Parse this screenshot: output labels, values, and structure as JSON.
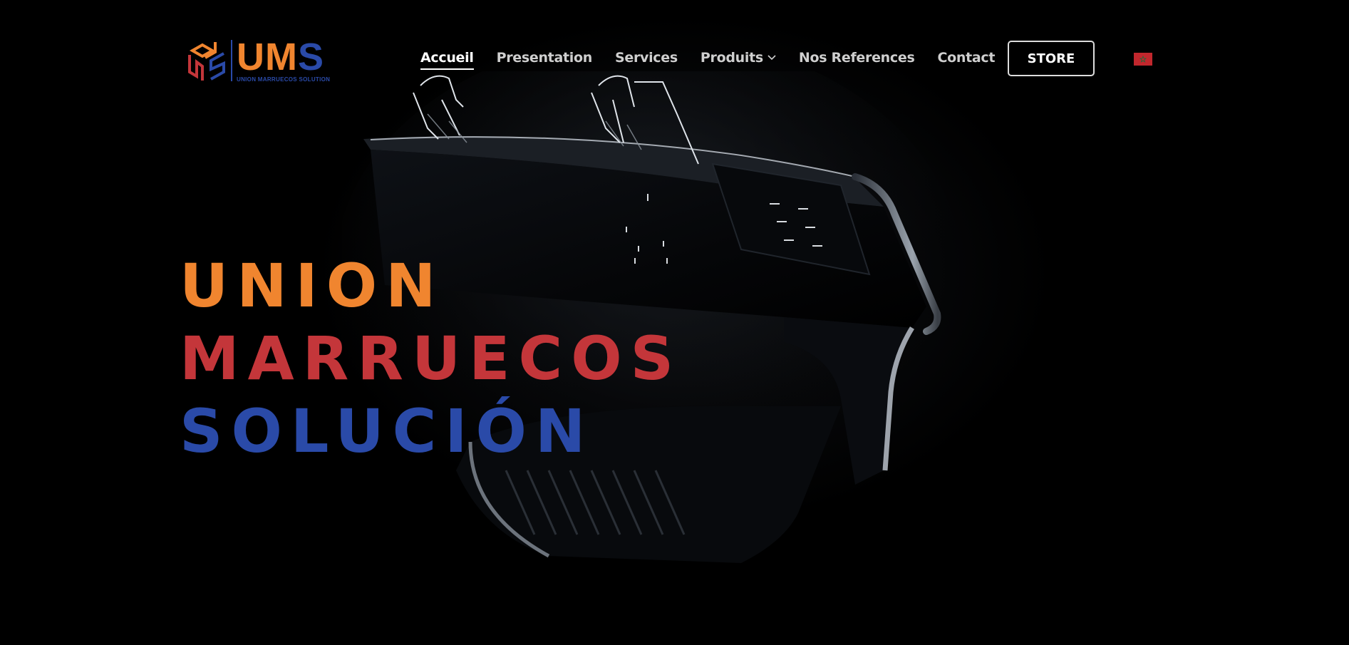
{
  "brand": {
    "logo_letters": [
      "U",
      "M",
      "S"
    ],
    "logo_subtitle": "UNION MARRUECOS SOLUTION"
  },
  "nav": {
    "items": [
      {
        "label": "Accueil",
        "active": true
      },
      {
        "label": "Presentation"
      },
      {
        "label": "Services"
      },
      {
        "label": "Produits",
        "has_dropdown": true
      },
      {
        "label": "Nos References"
      },
      {
        "label": "Contact"
      }
    ],
    "store_label": "STORE",
    "language_flag": "morocco-flag-icon"
  },
  "hero": {
    "line1": "UNION",
    "line2": "MARRUECOS",
    "line3": "SOLUCIÓN"
  },
  "colors": {
    "orange": "#f0852f",
    "red": "#c4363a",
    "blue": "#2a4aa8",
    "flag_red": "#c1272d"
  }
}
